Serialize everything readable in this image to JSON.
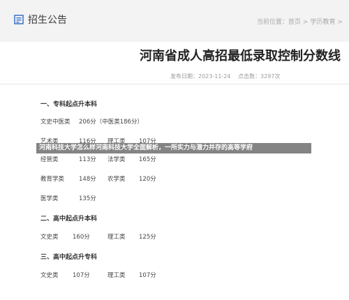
{
  "header": {
    "title": "招生公告",
    "breadcrumb": {
      "prefix": "当前位置：",
      "home": "首页",
      "sep": ">",
      "section": "学历教育",
      "sep2": ">"
    }
  },
  "article": {
    "title": "河南省成人高招最低录取控制分数线",
    "meta": {
      "date": "发布日期：2023-11-24",
      "views": "点击数：3297次"
    }
  },
  "sections": [
    {
      "title": "一、专科起点升本科",
      "rows": [
        [
          {
            "label": "文史中医类",
            "value": "206分（中医类186分）"
          }
        ],
        [
          {
            "label": "艺术类",
            "value": "116分"
          },
          {
            "label": "理工类",
            "value": "107分"
          }
        ],
        [
          {
            "label": "经管类",
            "value": "113分"
          },
          {
            "label": "法学类",
            "value": "165分"
          }
        ],
        [
          {
            "label": "教育学类",
            "value": "148分"
          },
          {
            "label": "农学类",
            "value": "120分"
          }
        ],
        [
          {
            "label": "医学类",
            "value": "135分"
          }
        ]
      ]
    },
    {
      "title": "二、高中起点升本科",
      "rows": [
        [
          {
            "label": "文史类",
            "value": "160分"
          },
          {
            "label": "理工类",
            "value": "125分"
          }
        ]
      ]
    },
    {
      "title": "三、高中起点升专科",
      "rows": [
        [
          {
            "label": "文史类",
            "value": "107分"
          },
          {
            "label": "理工类",
            "value": "107分"
          }
        ]
      ]
    }
  ],
  "overlay": {
    "caption": "河南科技大学怎么样河南科技大学全面解析，一所实力与潜力并存的高等学府"
  },
  "colors": {
    "brand_icon": "#3a6fc8",
    "overlay_bg": "#696969"
  }
}
